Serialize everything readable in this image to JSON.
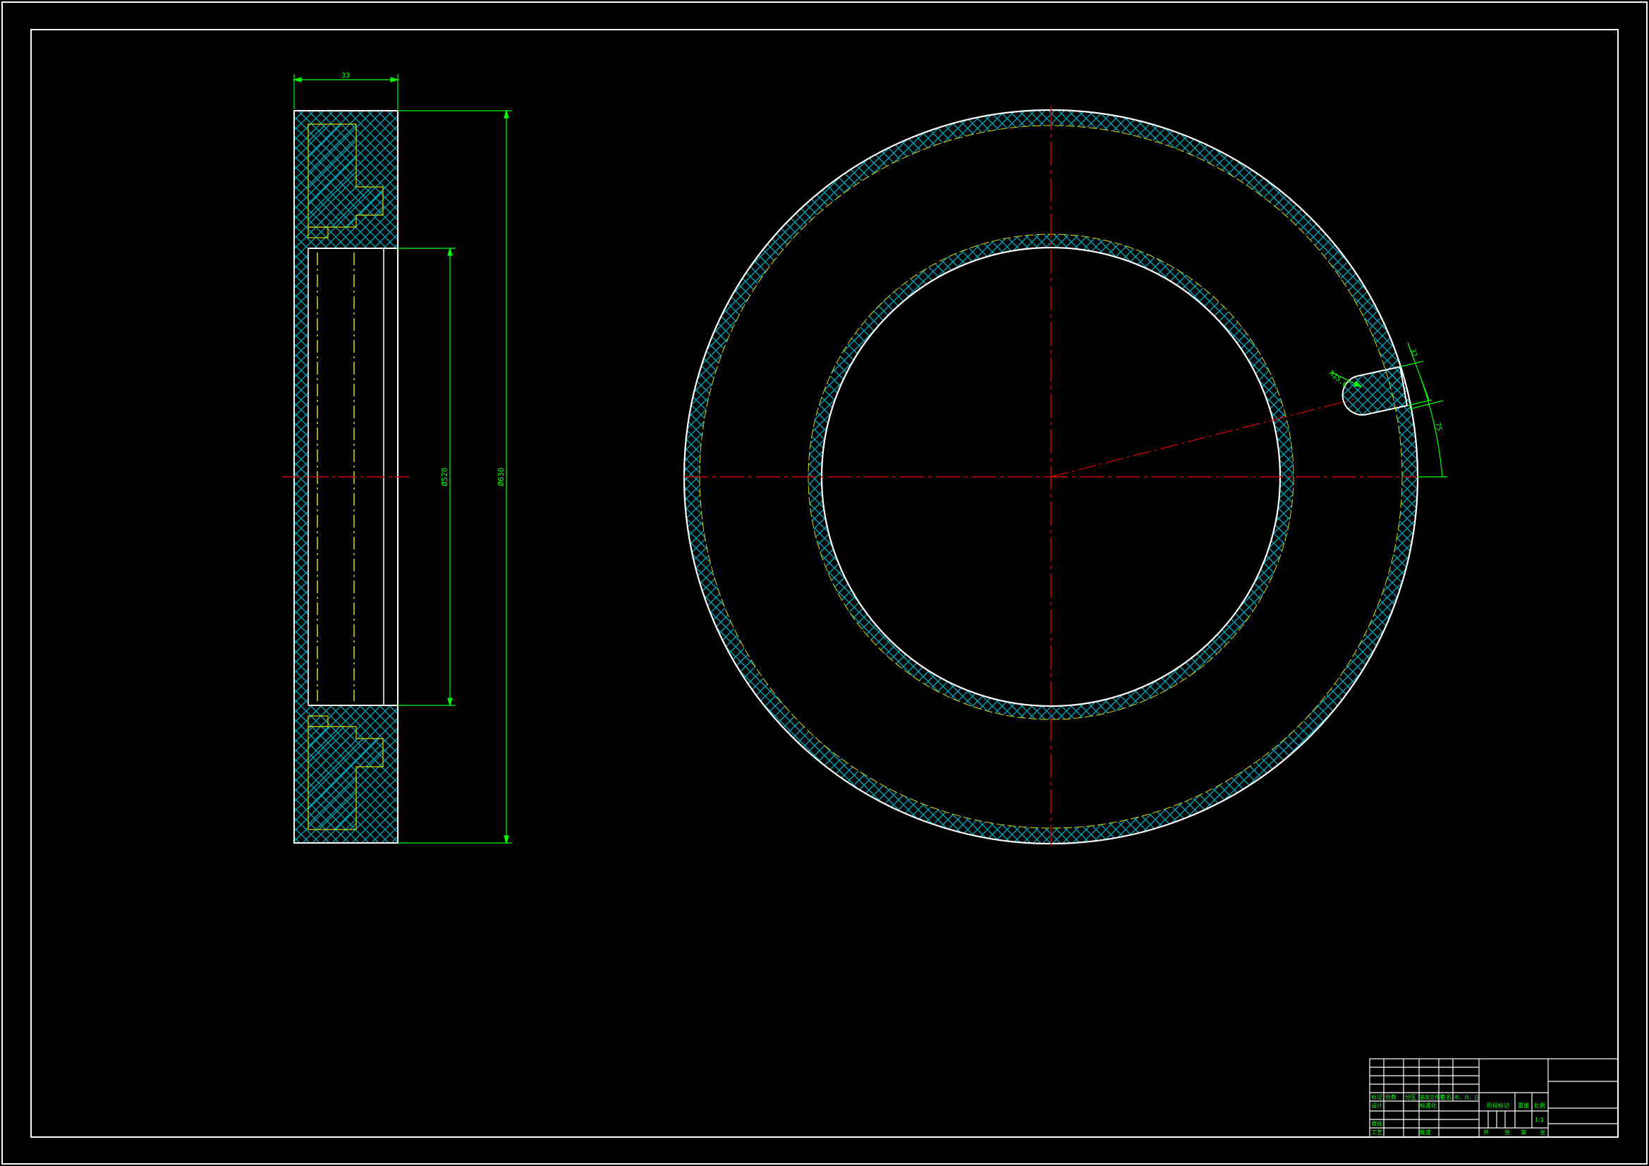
{
  "drawing": {
    "colors": {
      "background": "#000000",
      "outline": "#ffffff",
      "hatch": "#00a0b4",
      "dimension": "#00ff00",
      "centerline": "#c80000",
      "hidden": "#d8d800"
    },
    "side_view": {
      "dim_width": "33",
      "dim_bore": "Ø520",
      "dim_outer": "Ø630"
    },
    "front_view": {
      "dim_slot_radius": "R15.6",
      "dim_slot_width": "32",
      "dim_slot_depth": "75"
    },
    "title_block": {
      "rev_headers": [
        "标记",
        "处数",
        "分区",
        "更改文件号",
        "签名",
        "年、月、日"
      ],
      "row_design": "设计",
      "row_standard": "标准化",
      "row_check": "审核",
      "row_process": "工艺",
      "row_approve": "批准",
      "stage_label": "阶段标记",
      "weight_label": "重量",
      "scale_label": "比例",
      "scale_value": "1:1",
      "sheet_total": "共",
      "sheet_unit": "张",
      "sheet_no": "第",
      "sheet_unit2": "张"
    }
  }
}
